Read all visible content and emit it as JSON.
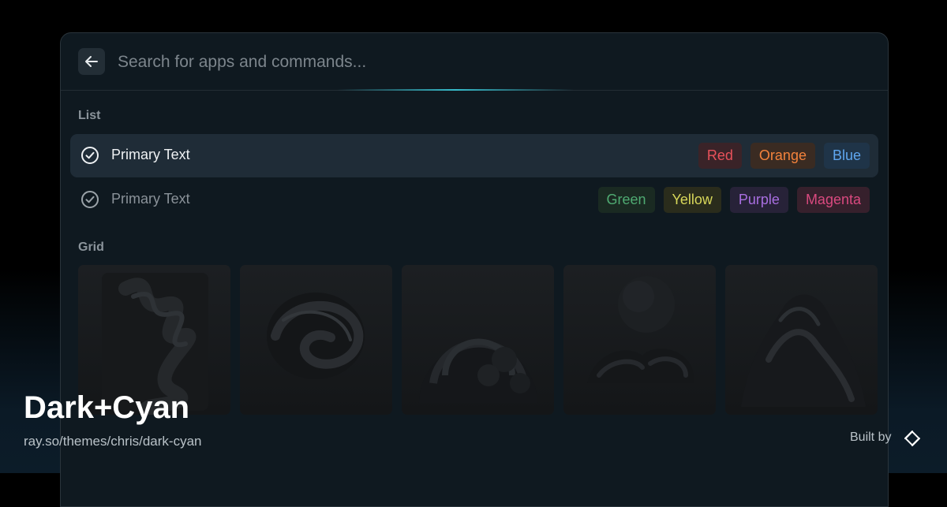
{
  "search": {
    "placeholder": "Search for apps and commands..."
  },
  "list": {
    "title": "List",
    "rows": [
      {
        "label": "Primary Text",
        "selected": true,
        "tags": [
          {
            "label": "Red",
            "color": "#e8515a",
            "bg": "#3a2328"
          },
          {
            "label": "Orange",
            "color": "#f3823c",
            "bg": "#3a2b22"
          },
          {
            "label": "Blue",
            "color": "#5fa6ef",
            "bg": "#1f3448"
          }
        ]
      },
      {
        "label": "Primary Text",
        "selected": false,
        "tags": [
          {
            "label": "Green",
            "color": "#4faa72",
            "bg": "#1a2a22"
          },
          {
            "label": "Yellow",
            "color": "#d8d75a",
            "bg": "#2a2c1c"
          },
          {
            "label": "Purple",
            "color": "#a86ee0",
            "bg": "#272238"
          },
          {
            "label": "Magenta",
            "color": "#d9497f",
            "bg": "#36202c"
          }
        ]
      }
    ]
  },
  "grid": {
    "title": "Grid",
    "items": [
      {
        "icon": "wave-sculpture-image"
      },
      {
        "icon": "swirl-sculpture-image"
      },
      {
        "icon": "sphere-sculpture-image"
      },
      {
        "icon": "orb-clouds-sculpture-image"
      },
      {
        "icon": "rock-sculpture-image"
      }
    ]
  },
  "footer": {
    "theme_name": "Dark+Cyan",
    "theme_url": "ray.so/themes/chris/dark-cyan",
    "built_by": "Built by"
  },
  "colors": {
    "accent": "#3accdc"
  }
}
